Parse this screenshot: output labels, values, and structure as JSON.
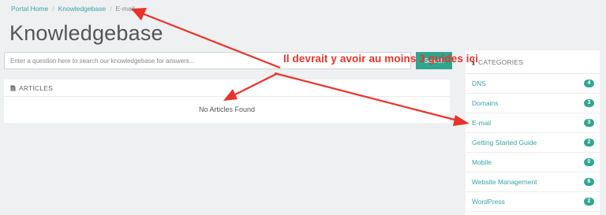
{
  "breadcrumb": {
    "items": [
      {
        "label": "Portal Home"
      },
      {
        "label": "Knowledgebase"
      },
      {
        "label": "E-mail"
      }
    ],
    "separator": "/"
  },
  "page": {
    "title": "Knowledgebase"
  },
  "search": {
    "placeholder": "Enter a question here to search our knowledgebase for answers...",
    "value": "",
    "button_label": "Search"
  },
  "articles": {
    "header": "ARTICLES",
    "empty_text": "No Articles Found"
  },
  "categories": {
    "header": "CATEGORIES",
    "items": [
      {
        "label": "DNS",
        "count": "4"
      },
      {
        "label": "Domains",
        "count": "3"
      },
      {
        "label": "E-mail",
        "count": "3"
      },
      {
        "label": "Getting Started Guide",
        "count": "2"
      },
      {
        "label": "Mobile",
        "count": "0"
      },
      {
        "label": "Website Management",
        "count": "6"
      },
      {
        "label": "WordPress",
        "count": "2"
      }
    ]
  },
  "annotation": {
    "text": "Il devrait y avoir au moins 3 guides ici",
    "color": "#e8332a"
  },
  "colors": {
    "accent": "#2fa68f",
    "link": "#3aa3a3",
    "background": "#eef0f2"
  }
}
